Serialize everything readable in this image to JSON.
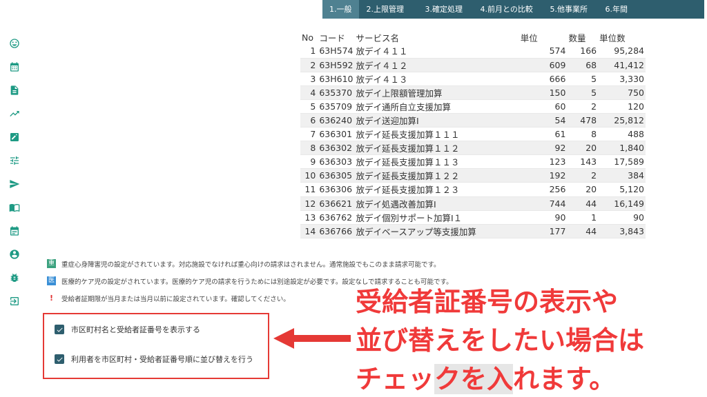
{
  "tabs": [
    {
      "label": "1.一般",
      "active": true
    },
    {
      "label": "2.上限管理",
      "active": false
    },
    {
      "label": "3.確定処理",
      "active": false
    },
    {
      "label": "4.前月との比較",
      "active": false
    },
    {
      "label": "5.他事業所",
      "active": false
    },
    {
      "label": "6.年間",
      "active": false
    }
  ],
  "sidebar": {
    "icons": [
      "smiley-icon",
      "calendar-icon",
      "document-icon",
      "trending-icon",
      "edit-icon",
      "tune-icon",
      "send-icon",
      "book-icon",
      "event-icon",
      "account-icon",
      "bug-icon",
      "logout-icon"
    ]
  },
  "table": {
    "headers": {
      "no": "No",
      "code": "コード",
      "name": "サービス名",
      "unit": "単位",
      "qty": "数量",
      "units": "単位数"
    },
    "rows": [
      {
        "no": "1",
        "code": "63H574",
        "name": "放デイ４１１",
        "unit": "574",
        "qty": "166",
        "units": "95,284"
      },
      {
        "no": "2",
        "code": "63H592",
        "name": "放デイ４１２",
        "unit": "609",
        "qty": "68",
        "units": "41,412"
      },
      {
        "no": "3",
        "code": "63H610",
        "name": "放デイ４１３",
        "unit": "666",
        "qty": "5",
        "units": "3,330"
      },
      {
        "no": "4",
        "code": "635370",
        "name": "放デイ上限額管理加算",
        "unit": "150",
        "qty": "5",
        "units": "750"
      },
      {
        "no": "5",
        "code": "635709",
        "name": "放デイ通所自立支援加算",
        "unit": "60",
        "qty": "2",
        "units": "120"
      },
      {
        "no": "6",
        "code": "636240",
        "name": "放デイ送迎加算Ⅰ",
        "unit": "54",
        "qty": "478",
        "units": "25,812"
      },
      {
        "no": "7",
        "code": "636301",
        "name": "放デイ延長支援加算１１１",
        "unit": "61",
        "qty": "8",
        "units": "488"
      },
      {
        "no": "8",
        "code": "636302",
        "name": "放デイ延長支援加算１１２",
        "unit": "92",
        "qty": "20",
        "units": "1,840"
      },
      {
        "no": "9",
        "code": "636303",
        "name": "放デイ延長支援加算１１３",
        "unit": "123",
        "qty": "143",
        "units": "17,589"
      },
      {
        "no": "10",
        "code": "636305",
        "name": "放デイ延長支援加算１２２",
        "unit": "192",
        "qty": "2",
        "units": "384"
      },
      {
        "no": "11",
        "code": "636306",
        "name": "放デイ延長支援加算１２３",
        "unit": "256",
        "qty": "20",
        "units": "5,120"
      },
      {
        "no": "12",
        "code": "636621",
        "name": "放デイ処遇改善加算Ⅰ",
        "unit": "744",
        "qty": "44",
        "units": "16,149"
      },
      {
        "no": "13",
        "code": "636762",
        "name": "放デイ個別サポート加算Ⅰ１",
        "unit": "90",
        "qty": "1",
        "units": "90"
      },
      {
        "no": "14",
        "code": "636766",
        "name": "放デイベースアップ等支援加算",
        "unit": "177",
        "qty": "44",
        "units": "3,843"
      }
    ]
  },
  "notes": [
    {
      "badge": "重",
      "text": "重症心身障害児の設定がされています。対応施設でなければ重心向けの請求はされません。通常施設でもこのまま請求可能です。"
    },
    {
      "badge": "医",
      "text": "医療的ケア児の設定がされています。医療的ケア児の請求を行うためには別途設定が必要です。設定なしで請求することも可能です。"
    },
    {
      "badge": "!",
      "text": "受給者証期限が当月または当月以前に設定されています。確認してください。"
    }
  ],
  "checkboxes": [
    {
      "label": "市区町村名と受給者証番号を表示する",
      "checked": true
    },
    {
      "label": "利用者を市区町村・受給者証番号順に並び替えを行う",
      "checked": true
    }
  ],
  "callout": {
    "line1": "受給者証番号の表示や",
    "line2": "並び替えをしたい場合は",
    "line3a": "チェッ",
    "line3b": "クを入",
    "line3c": "れます。"
  },
  "colors": {
    "tabbar": "#2e5e6e",
    "tab_active": "#4f8191",
    "icon": "#1e9a84",
    "callout": "#f03a3a",
    "frame": "#e53935"
  }
}
